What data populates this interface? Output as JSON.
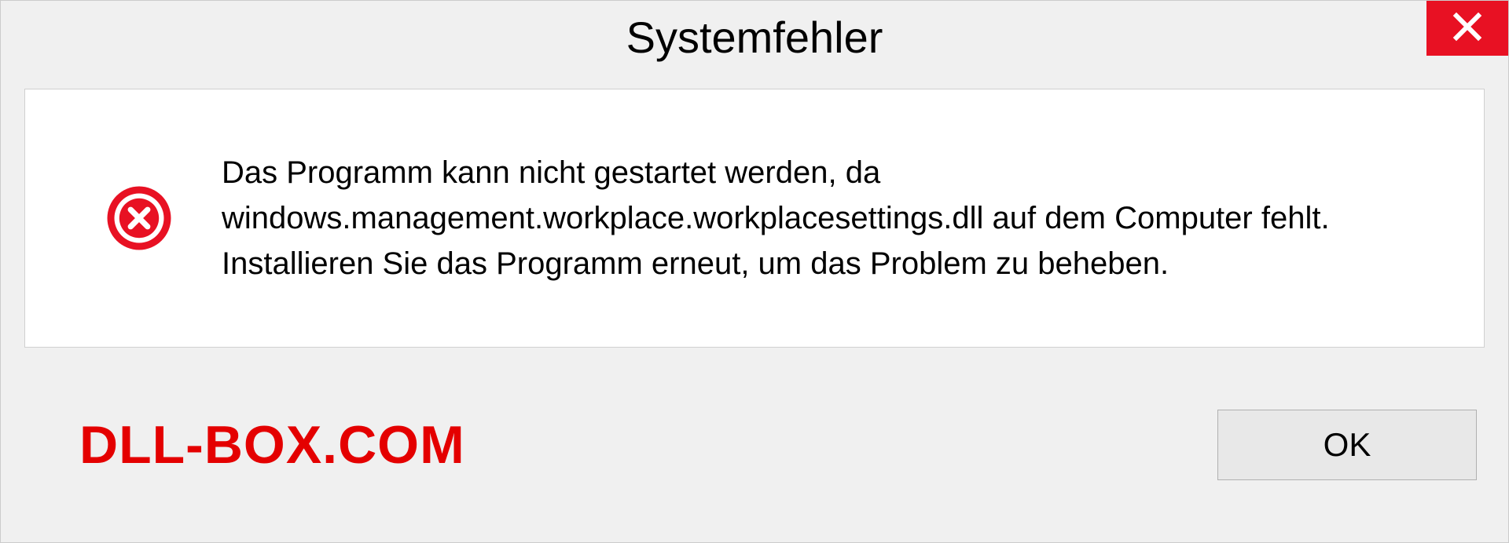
{
  "dialog": {
    "title": "Systemfehler",
    "message": "Das Programm kann nicht gestartet werden, da windows.management.workplace.workplacesettings.dll auf dem Computer fehlt. Installieren Sie das Programm erneut, um das Problem zu beheben.",
    "ok_label": "OK"
  },
  "watermark": "DLL-BOX.COM"
}
